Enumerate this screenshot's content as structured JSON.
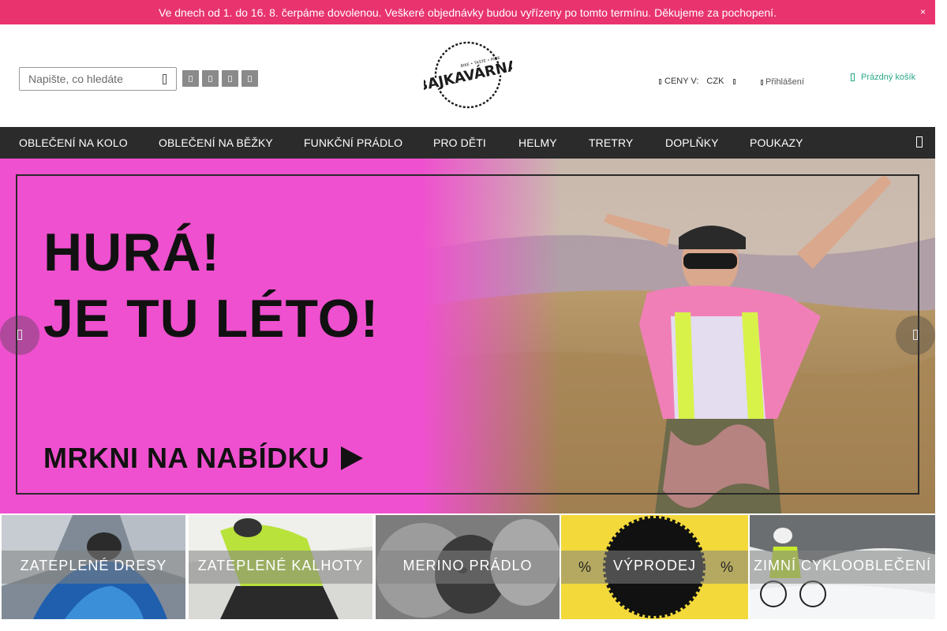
{
  "notice": {
    "text": "Ve dnech od 1. do 16. 8. čerpáme dovolenou. Veškeré objednávky budou vyřízeny po tomto termínu. Děkujeme za pochopení."
  },
  "header": {
    "search_placeholder": "Napište, co hledáte",
    "prices_label": "CENY V:",
    "currency": "CZK",
    "login_label": "Přihlášení",
    "cart_label": "Prázdný košík",
    "logo_text": "BAJKAVÁRNA",
    "logo_tagline": "BIKE • TASTE • RIDE"
  },
  "nav": {
    "items": [
      "OBLEČENÍ NA KOLO",
      "OBLEČENÍ NA BĚŽKY",
      "FUNKČNÍ PRÁDLO",
      "PRO DĚTI",
      "HELMY",
      "TRETRY",
      "DOPLŇKY",
      "POUKAZY"
    ]
  },
  "hero": {
    "title_line1": "HURÁ!",
    "title_line2": "JE TU LÉTO!",
    "cta": "MRKNI NA NABÍDKU"
  },
  "categories": [
    {
      "label": "ZATEPLENÉ DRESY"
    },
    {
      "label": "ZATEPLENÉ KALHOTY"
    },
    {
      "label": "MERINO PRÁDLO"
    },
    {
      "label": "VÝPRODEJ",
      "mark": "%"
    },
    {
      "label": "ZIMNÍ CYKLOOBLEČENÍ"
    }
  ],
  "colors": {
    "notice_bg": "#e8336f",
    "nav_bg": "#2b2b2b",
    "hero_pink": "#ef50cf",
    "cart_accent": "#2ba889",
    "sale_yellow": "#f3d93a"
  },
  "icons": {
    "search": "search-icon",
    "social": [
      "facebook-icon",
      "instagram-icon",
      "youtube-icon",
      "strava-icon"
    ],
    "login": "user-icon",
    "cart": "cart-icon",
    "close": "close-icon"
  }
}
